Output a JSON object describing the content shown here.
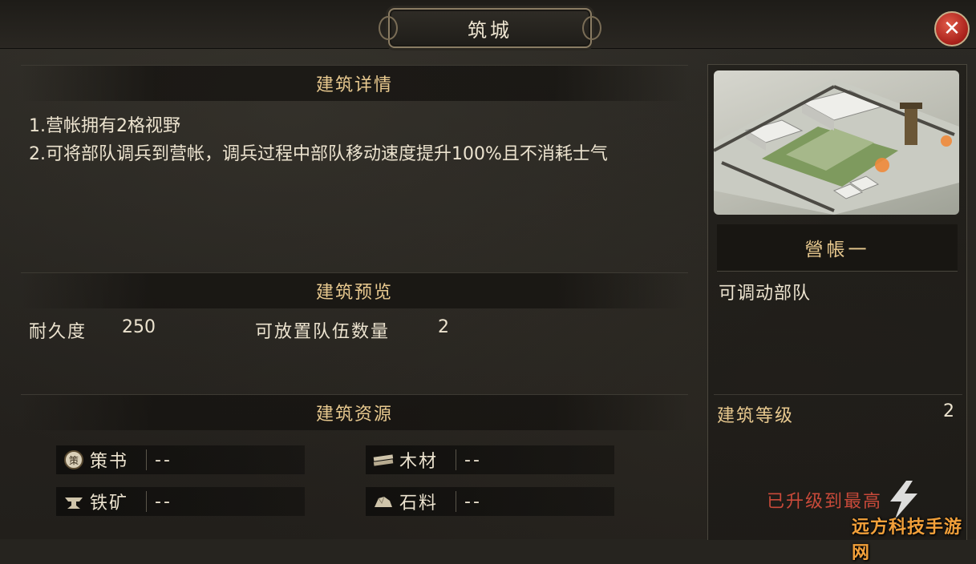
{
  "window": {
    "title": "筑城",
    "close_icon": "close-icon"
  },
  "details": {
    "heading": "建筑详情",
    "lines": [
      "1.营帐拥有2格视野",
      "2.可将部队调兵到营帐，调兵过程中部队移动速度提升100%且不消耗士气"
    ]
  },
  "preview": {
    "heading": "建筑预览",
    "durability_label": "耐久度",
    "durability_value": "250",
    "troops_label": "可放置队伍数量",
    "troops_value": "2"
  },
  "resources": {
    "heading": "建筑资源",
    "items": [
      {
        "icon": "strategy-book-icon",
        "name": "策书",
        "value": "--"
      },
      {
        "icon": "wood-icon",
        "name": "木材",
        "value": "--"
      },
      {
        "icon": "iron-ore-icon",
        "name": "铁矿",
        "value": "--"
      },
      {
        "icon": "stone-icon",
        "name": "石料",
        "value": "--"
      }
    ]
  },
  "building": {
    "name": "營帳一",
    "description": "可调动部队",
    "level_label": "建筑等级",
    "level_value": "2",
    "status": "已升级到最高"
  },
  "watermark": "远方科技手游网",
  "colors": {
    "heading_gold": "#e8c98f",
    "text": "#ece3cf",
    "status_red": "#c94a3a",
    "close_red": "#a8201a",
    "watermark_orange": "#f2a03a"
  }
}
